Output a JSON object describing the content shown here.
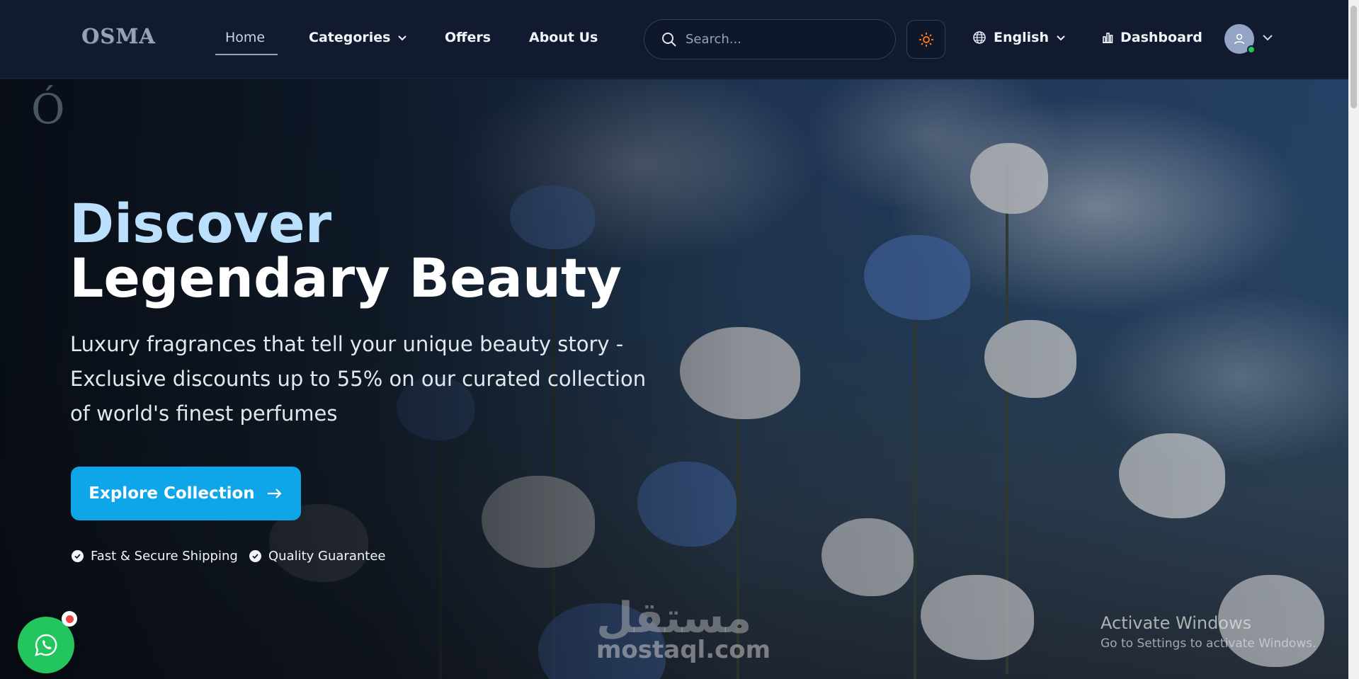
{
  "header": {
    "logo": "OSMA",
    "nav": [
      {
        "label": "Home",
        "active": true
      },
      {
        "label": "Categories",
        "has_dropdown": true
      },
      {
        "label": "Offers"
      },
      {
        "label": "About Us"
      }
    ],
    "search": {
      "placeholder": "Search...",
      "value": ""
    },
    "theme_icon": "sun-icon",
    "language": "English",
    "dashboard": "Dashboard",
    "user_status": "online"
  },
  "hero": {
    "brand_mark": "Ó",
    "title_line1": "Discover",
    "title_line2": "Legendary Beauty",
    "subtitle": "Luxury fragrances that tell your unique beauty story - Exclusive discounts up to 55% on our curated collection of world's finest perfumes",
    "cta_label": "Explore Collection",
    "features": [
      "Fast & Secure Shipping",
      "Quality Guarantee"
    ]
  },
  "overlays": {
    "watermark_arabic": "مستقل",
    "watermark_site": "mostaql.com",
    "activate_title": "Activate Windows",
    "activate_subtitle": "Go to Settings to activate Windows."
  },
  "colors": {
    "accent": "#0ea5e9",
    "title_accent": "#bae0fd",
    "nav_bg": "#111a2e",
    "whatsapp": "#22c55e",
    "badge": "#ef4444"
  }
}
